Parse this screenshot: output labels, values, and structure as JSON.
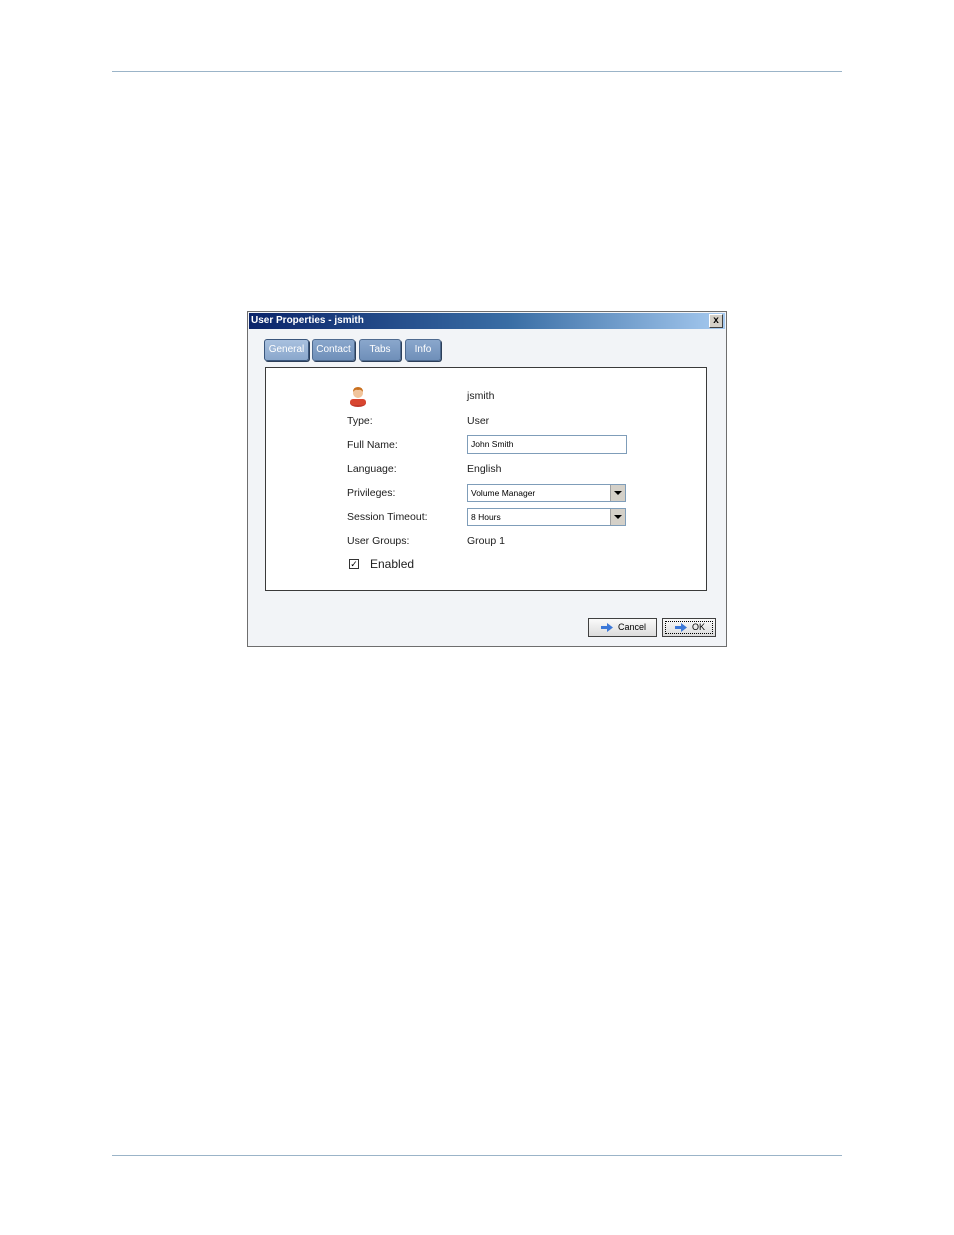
{
  "dialog": {
    "title": "User Properties - jsmith",
    "close_glyph": "x",
    "tabs": [
      {
        "label": "General",
        "active": true
      },
      {
        "label": "Contact",
        "active": false
      },
      {
        "label": "Tabs",
        "active": false
      },
      {
        "label": "Info",
        "active": false
      }
    ],
    "user": {
      "icon": "user-icon",
      "username": "jsmith"
    },
    "fields": {
      "type_label": "Type:",
      "type_value": "User",
      "fullname_label": "Full Name:",
      "fullname_value": "John Smith",
      "language_label": "Language:",
      "language_value": "English",
      "privileges_label": "Privileges:",
      "privileges_value": "Volume Manager",
      "timeout_label": "Session Timeout:",
      "timeout_value": "8 Hours",
      "groups_label": "User Groups:",
      "groups_value": "Group 1"
    },
    "enabled": {
      "label": "Enabled",
      "checked": true,
      "check_glyph": "✓"
    },
    "buttons": {
      "cancel": "Cancel",
      "ok": "OK"
    }
  },
  "colors": {
    "titlebar_start": "#0a246a",
    "titlebar_end": "#a6caf0",
    "tab": "#6f8fb9",
    "rule": "#9bb4c8"
  }
}
